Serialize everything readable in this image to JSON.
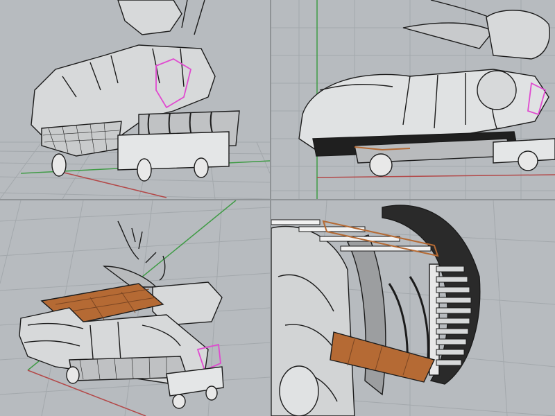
{
  "app": {
    "viewports": [
      {
        "id": "top-left",
        "label": ""
      },
      {
        "id": "top-right",
        "label": ""
      },
      {
        "id": "bottom-left",
        "label": ""
      },
      {
        "id": "bottom-right",
        "label": ""
      }
    ]
  },
  "colors": {
    "background": "#b7bbbf",
    "grid": "#a3a8ac",
    "x_axis": "#b34848",
    "y_axis": "#3f9b45",
    "body": "#d7d9da",
    "outline": "#1b1b1b",
    "highlight": "#e04ad0",
    "wood": "#b56a34",
    "wheel": "#e8e8e8"
  },
  "icons": {
    "x_axis": "red-axis-line-icon",
    "y_axis": "green-axis-line-icon"
  }
}
